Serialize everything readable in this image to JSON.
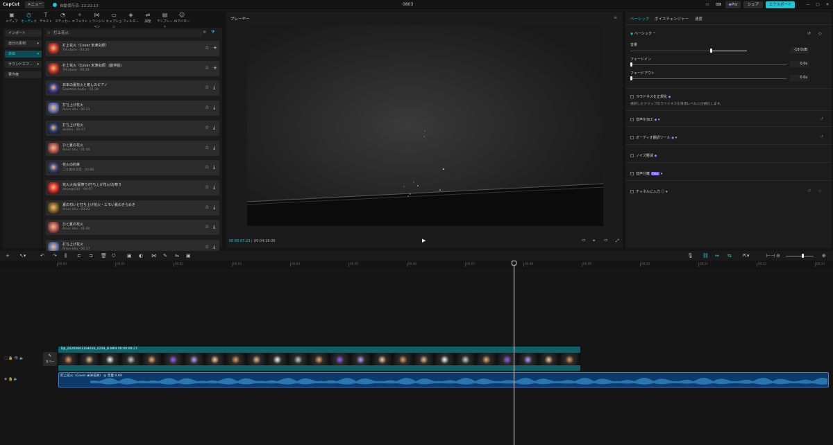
{
  "titlebar": {
    "logo": "CapCut",
    "menu": "メニュー",
    "autosave": "自動保存済: 22:22:13",
    "project": "0803",
    "pro": "Pro",
    "share": "シェア",
    "export": "エクスポート"
  },
  "media_tabs": [
    {
      "label": "メディア",
      "icon": "media-icon"
    },
    {
      "label": "オーディオ",
      "icon": "audio-icon",
      "active": true
    },
    {
      "label": "テキスト",
      "icon": "text-icon"
    },
    {
      "label": "ステッカー",
      "icon": "sticker-icon"
    },
    {
      "label": "エフェクト",
      "icon": "effect-icon"
    },
    {
      "label": "トランジション",
      "icon": "transition-icon"
    },
    {
      "label": "キャプション",
      "icon": "caption-icon"
    },
    {
      "label": "フィルター",
      "icon": "filter-icon"
    },
    {
      "label": "調整",
      "icon": "adjust-icon"
    },
    {
      "label": "テンプレート",
      "icon": "template-icon"
    },
    {
      "label": "AIアバター",
      "icon": "ai-avatar-icon"
    }
  ],
  "leftnav": [
    {
      "label": "インポート"
    },
    {
      "label": "自分の素材",
      "caret": "▾"
    },
    {
      "label": "楽曲",
      "caret": "▾",
      "selected": true
    },
    {
      "label": "サウンドエフ...",
      "caret": "▾"
    },
    {
      "label": "著作権"
    }
  ],
  "search": {
    "value": "打上花火"
  },
  "tracks": [
    {
      "title": "打上花火（Cover 米津玄師）",
      "sub": "YM.stone · 04:16",
      "color": "#c23a2a"
    },
    {
      "title": "打上花火（Cover 米津玄師）(劇伴版)",
      "sub": "YM.stone · 00:19",
      "color": "#c23a2a"
    },
    {
      "title": "日本の夏花火と癒しのピアノ",
      "sub": "Sokoteia Audio · 02:38",
      "color": "#3a3f8a"
    },
    {
      "title": "打ち上げ花火",
      "sub": "Ariun situ · 00:31",
      "color": "#6b78b5"
    },
    {
      "title": "打ち上げ花火",
      "sub": "akiohu · 02:57",
      "color": "#2a3f7a"
    },
    {
      "title": "ひと夏の花火",
      "sub": "Ariun situ · 01:00",
      "color": "#b75a5a"
    },
    {
      "title": "花火の約束",
      "sub": "二斗葉の日常 · 03:08",
      "color": "#3b4478"
    },
    {
      "title": "花火大会/夏祭り/打ち上げ花火/お祭り",
      "sub": "okunigiri22 · 00:07",
      "color": "#e03030"
    },
    {
      "title": "夏の匂いと打ち上げ花火・エモい夏のきらめき",
      "sub": "Ariun situ · 03:43",
      "color": "#8a6a2a"
    },
    {
      "title": "ひと夏の花火",
      "sub": "Ariun situ · 01:00",
      "color": "#b75a5a"
    },
    {
      "title": "打ち上げ花火",
      "sub": "Ariun situ · 00:17",
      "color": "#6b78b5"
    }
  ],
  "player": {
    "title": "プレーヤー",
    "current": "00:00:07:23",
    "duration": "00:04:18:06"
  },
  "props": {
    "tabs": [
      "ベーシック",
      "ボイスチェンジャー",
      "速度"
    ],
    "section": "ベーシック",
    "volume_label": "音量",
    "volume_value": "-18.0dB",
    "fadein_label": "フェードイン",
    "fadein_value": "0.0s",
    "fadeout_label": "フェードアウト",
    "fadeout_value": "0.0s",
    "loudness": "ラウドネスを正規化",
    "loudness_desc": "選択したクリップのラウドネスを目標レベルに正規化します。",
    "voice_fx": "音声を加工",
    "audio_tools": "オーディオ翻訳ツール",
    "noise": "ノイズ軽減",
    "separation": "音声分離",
    "separation_badge": "Free",
    "channel": "チャネルに入力"
  },
  "timeline": {
    "ticks": [
      "00:00",
      "00:01",
      "00:02",
      "00:03",
      "00:04",
      "00:05",
      "00:06",
      "00:07",
      "00:08",
      "00:09",
      "00:10",
      "00:11",
      "00:12",
      "00:13"
    ],
    "cover": "カバー",
    "video_clip": "DJI_20260801194650_0259_D.MP4  00:00:08:27",
    "audio_clip": "打上花火（Cover 米津玄師）  ◎  音量 0.9X"
  }
}
